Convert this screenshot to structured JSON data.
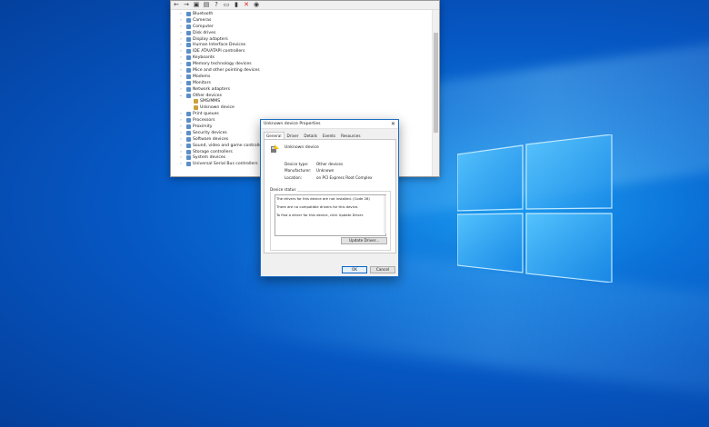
{
  "device_manager": {
    "toolbar_icons": [
      "back-arrow-icon",
      "forward-arrow-icon",
      "computer-icon",
      "properties-icon",
      "help-icon",
      "monitor-icon",
      "update-driver-icon",
      "uninstall-icon",
      "scan-icon"
    ],
    "items": [
      {
        "label": "Bluetooth",
        "expanded": false
      },
      {
        "label": "Cameras",
        "expanded": false
      },
      {
        "label": "Computer",
        "expanded": false
      },
      {
        "label": "Disk drives",
        "expanded": false
      },
      {
        "label": "Display adapters",
        "expanded": false
      },
      {
        "label": "Human Interface Devices",
        "expanded": false
      },
      {
        "label": "IDE ATA/ATAPI controllers",
        "expanded": false
      },
      {
        "label": "Keyboards",
        "expanded": false
      },
      {
        "label": "Memory technology devices",
        "expanded": false
      },
      {
        "label": "Mice and other pointing devices",
        "expanded": false
      },
      {
        "label": "Modems",
        "expanded": false
      },
      {
        "label": "Monitors",
        "expanded": false
      },
      {
        "label": "Network adapters",
        "expanded": false
      },
      {
        "label": "Other devices",
        "expanded": true
      },
      {
        "label": "SMS/MMS",
        "child": true
      },
      {
        "label": "Unknown device",
        "child": true
      },
      {
        "label": "Print queues",
        "expanded": false
      },
      {
        "label": "Processors",
        "expanded": false
      },
      {
        "label": "Proximity",
        "expanded": false
      },
      {
        "label": "Security devices",
        "expanded": false
      },
      {
        "label": "Software devices",
        "expanded": false
      },
      {
        "label": "Sound, video and game controllers",
        "expanded": false
      },
      {
        "label": "Storage controllers",
        "expanded": false
      },
      {
        "label": "System devices",
        "expanded": false
      },
      {
        "label": "Universal Serial Bus controllers",
        "expanded": false
      }
    ]
  },
  "dialog": {
    "title": "Unknown device Properties",
    "tabs": [
      "General",
      "Driver",
      "Details",
      "Events",
      "Resources"
    ],
    "active_tab": "General",
    "device_name": "Unknown device",
    "properties": [
      {
        "label": "Device type:",
        "value": "Other devices"
      },
      {
        "label": "Manufacturer:",
        "value": "Unknown"
      },
      {
        "label": "Location:",
        "value": "on PCI Express Root Complex"
      }
    ],
    "status_legend": "Device status",
    "status_lines": [
      "The drivers for this device are not installed. (Code 28)",
      "There are no compatible drivers for this device.",
      "To find a driver for this device, click Update Driver."
    ],
    "update_driver_label": "Update Driver...",
    "ok_label": "OK",
    "cancel_label": "Cancel"
  },
  "colors": {
    "desktop_blue": "#0656c2",
    "accent": "#1f6fc4"
  }
}
